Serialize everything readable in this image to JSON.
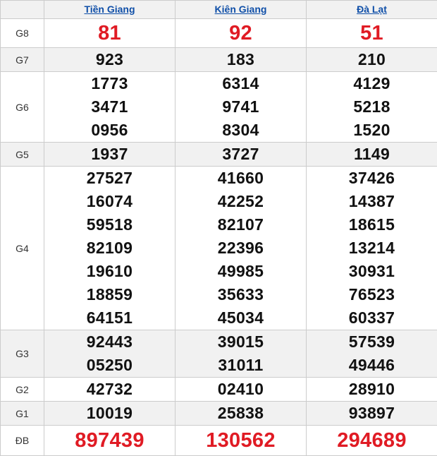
{
  "header": {
    "provinces": [
      "Tiền Giang",
      "Kiên Giang",
      "Đà Lạt"
    ]
  },
  "colors": {
    "special": "#e01b24",
    "link": "#0f4fa8",
    "alt_row": "#f1f1f1"
  },
  "prizes": [
    {
      "label": "G8",
      "values": [
        [
          "81"
        ],
        [
          "92"
        ],
        [
          "51"
        ]
      ]
    },
    {
      "label": "G7",
      "values": [
        [
          "923"
        ],
        [
          "183"
        ],
        [
          "210"
        ]
      ]
    },
    {
      "label": "G6",
      "values": [
        [
          "1773",
          "3471",
          "0956"
        ],
        [
          "6314",
          "9741",
          "8304"
        ],
        [
          "4129",
          "5218",
          "1520"
        ]
      ]
    },
    {
      "label": "G5",
      "values": [
        [
          "1937"
        ],
        [
          "3727"
        ],
        [
          "1149"
        ]
      ]
    },
    {
      "label": "G4",
      "values": [
        [
          "27527",
          "16074",
          "59518",
          "82109",
          "19610",
          "18859",
          "64151"
        ],
        [
          "41660",
          "42252",
          "82107",
          "22396",
          "49985",
          "35633",
          "45034"
        ],
        [
          "37426",
          "14387",
          "18615",
          "13214",
          "30931",
          "76523",
          "60337"
        ]
      ]
    },
    {
      "label": "G3",
      "values": [
        [
          "92443",
          "05250"
        ],
        [
          "39015",
          "31011"
        ],
        [
          "57539",
          "49446"
        ]
      ]
    },
    {
      "label": "G2",
      "values": [
        [
          "42732"
        ],
        [
          "02410"
        ],
        [
          "28910"
        ]
      ]
    },
    {
      "label": "G1",
      "values": [
        [
          "10019"
        ],
        [
          "25838"
        ],
        [
          "93897"
        ]
      ]
    },
    {
      "label": "ĐB",
      "values": [
        [
          "897439"
        ],
        [
          "130562"
        ],
        [
          "294689"
        ]
      ]
    }
  ]
}
